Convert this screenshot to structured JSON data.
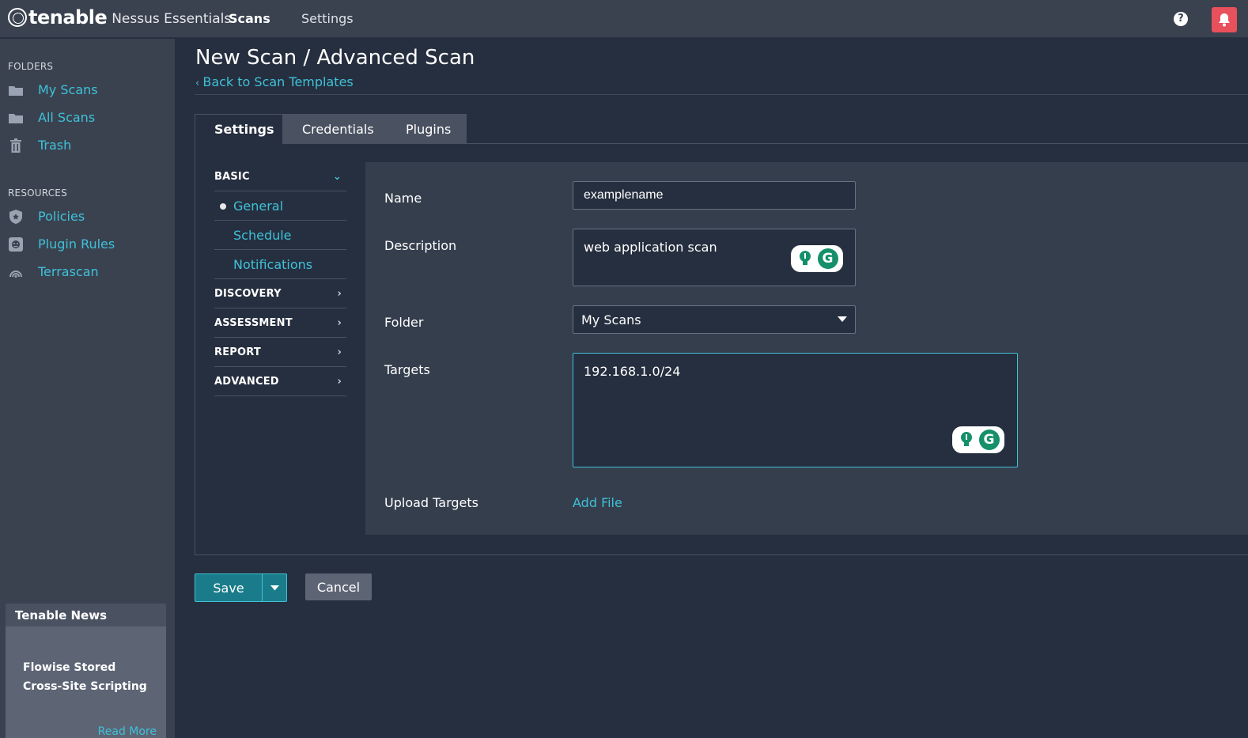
{
  "header": {
    "brand": "tenable",
    "product": "Nessus Essentials",
    "nav": [
      {
        "label": "Scans",
        "active": true
      },
      {
        "label": "Settings",
        "active": false
      }
    ],
    "help_icon": "question-circle-icon",
    "notification_icon": "bell-icon",
    "accent_color": "#e8505b"
  },
  "sidebar": {
    "folders_title": "FOLDERS",
    "folders": [
      {
        "label": "My Scans",
        "icon": "folder-icon"
      },
      {
        "label": "All Scans",
        "icon": "folder-icon"
      },
      {
        "label": "Trash",
        "icon": "trash-icon"
      }
    ],
    "resources_title": "RESOURCES",
    "resources": [
      {
        "label": "Policies",
        "icon": "shield-icon"
      },
      {
        "label": "Plugin Rules",
        "icon": "plugin-icon"
      },
      {
        "label": "Terrascan",
        "icon": "terrascan-icon"
      }
    ],
    "news": {
      "title": "Tenable News",
      "headline": "Flowise Stored Cross-Site Scripting",
      "read_more": "Read More"
    }
  },
  "page": {
    "title": "New Scan / Advanced Scan",
    "back_link": "Back to Scan Templates"
  },
  "tabs": [
    {
      "label": "Settings",
      "active": true
    },
    {
      "label": "Credentials",
      "active": false
    },
    {
      "label": "Plugins",
      "active": false
    }
  ],
  "leftnav": {
    "basic": "BASIC",
    "basic_items": [
      "General",
      "Schedule",
      "Notifications"
    ],
    "sections": [
      "DISCOVERY",
      "ASSESSMENT",
      "REPORT",
      "ADVANCED"
    ]
  },
  "form": {
    "name_label": "Name",
    "name_value": "examplename",
    "description_label": "Description",
    "description_value": "web application scan",
    "folder_label": "Folder",
    "folder_value": "My Scans",
    "targets_label": "Targets",
    "targets_value": "192.168.1.0/24",
    "upload_label": "Upload Targets",
    "add_file": "Add File"
  },
  "actions": {
    "save": "Save",
    "cancel": "Cancel"
  },
  "colors": {
    "link": "#3fc1d8",
    "save_button": "#1a7c8a",
    "grammarly_green": "#15906b"
  }
}
